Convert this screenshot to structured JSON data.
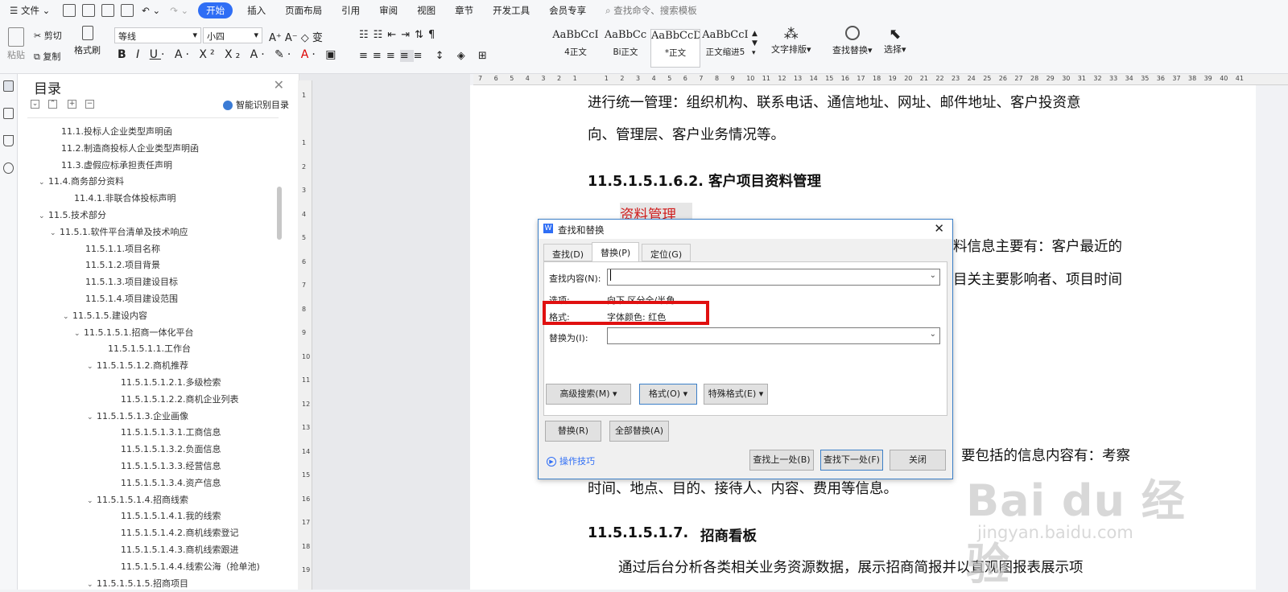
{
  "menubar": {
    "file": "文件",
    "tabs": [
      "开始",
      "插入",
      "页面布局",
      "引用",
      "审阅",
      "视图",
      "章节",
      "开发工具",
      "会员专享"
    ],
    "active_tab": "开始",
    "search_placeholder": "查找命令、搜索模板"
  },
  "ribbon": {
    "paste": "粘贴",
    "cut": "剪切",
    "copy": "复制",
    "format_painter": "格式刷",
    "font_name": "等线",
    "font_size": "小四",
    "styles": [
      {
        "preview": "AaBbCcI",
        "label": "4正文"
      },
      {
        "preview": "AaBbCc",
        "label": "Bi正文"
      },
      {
        "preview": "AaBbCcDc",
        "label": "*正文"
      },
      {
        "preview": "AaBbCcI",
        "label": "正文缩进5"
      }
    ],
    "text_layout": "文字排版",
    "find_replace": "查找替换",
    "select": "选择"
  },
  "toc": {
    "title": "目录",
    "smart": "智能识别目录",
    "items": [
      {
        "text": "11.1.投标人企业类型声明函",
        "caret": ""
      },
      {
        "text": "11.2.制造商投标人企业类型声明函",
        "caret": ""
      },
      {
        "text": "11.3.虚假应标承担责任声明",
        "caret": ""
      },
      {
        "text": "11.4.商务部分资料",
        "caret": "v"
      },
      {
        "text": "11.4.1.非联合体投标声明",
        "caret": ""
      },
      {
        "text": "11.5.技术部分",
        "caret": "v"
      },
      {
        "text": "11.5.1.软件平台清单及技术响应",
        "caret": "v"
      },
      {
        "text": "11.5.1.1.项目名称",
        "caret": ""
      },
      {
        "text": "11.5.1.2.项目背景",
        "caret": ""
      },
      {
        "text": "11.5.1.3.项目建设目标",
        "caret": ""
      },
      {
        "text": "11.5.1.4.项目建设范围",
        "caret": ""
      },
      {
        "text": "11.5.1.5.建设内容",
        "caret": "v"
      },
      {
        "text": "11.5.1.5.1.招商一体化平台",
        "caret": "v"
      },
      {
        "text": "11.5.1.5.1.1.工作台",
        "caret": ""
      },
      {
        "text": "11.5.1.5.1.2.商机推荐",
        "caret": "v"
      },
      {
        "text": "11.5.1.5.1.2.1.多级检索",
        "caret": ""
      },
      {
        "text": "11.5.1.5.1.2.2.商机企业列表",
        "caret": ""
      },
      {
        "text": "11.5.1.5.1.3.企业画像",
        "caret": "v"
      },
      {
        "text": "11.5.1.5.1.3.1.工商信息",
        "caret": ""
      },
      {
        "text": "11.5.1.5.1.3.2.负面信息",
        "caret": ""
      },
      {
        "text": "11.5.1.5.1.3.3.经营信息",
        "caret": ""
      },
      {
        "text": "11.5.1.5.1.3.4.资产信息",
        "caret": ""
      },
      {
        "text": "11.5.1.5.1.4.招商线索",
        "caret": "v"
      },
      {
        "text": "11.5.1.5.1.4.1.我的线索",
        "caret": ""
      },
      {
        "text": "11.5.1.5.1.4.2.商机线索登记",
        "caret": ""
      },
      {
        "text": "11.5.1.5.1.4.3.商机线索跟进",
        "caret": ""
      },
      {
        "text": "11.5.1.5.1.4.4.线索公海（抢单池)",
        "caret": ""
      },
      {
        "text": "11.5.1.5.1.5.招商项目",
        "caret": "v"
      }
    ]
  },
  "doc": {
    "line1": "进行统一管理：组织机构、联系电话、通信地址、网址、邮件地址、客户投资意",
    "line2": "向、管理层、客户业务情况等。",
    "heading1": "11.5.1.5.1.6.2.  客户项目资料管理",
    "highlight": "资料管理",
    "line3_tail": "料信息主要有：客户最近的",
    "line4_tail": "目关主要影响者、项目时间",
    "line5_tail": "要包括的信息内容有：考察",
    "line6": "时间、地点、目的、接待人、内容、费用等信息。",
    "heading2_num": "11.5.1.5.1.7.",
    "heading2_text": "招商看板",
    "line7": "通过后台分析各类相关业务资源数据，展示招商简报并以直观图报表展示项"
  },
  "dialog": {
    "title": "查找和替换",
    "tabs": [
      "查找(D)",
      "替换(P)",
      "定位(G)"
    ],
    "find_label": "查找内容(N):",
    "find_value": "",
    "options_label": "选项:",
    "options_value": "向下,区分全/半角",
    "format_label": "格式:",
    "format_value": "字体颜色: 红色",
    "replace_label": "替换为(I):",
    "replace_value": "",
    "advanced": "高级搜索(M)",
    "format_btn": "格式(O)",
    "special": "特殊格式(E)",
    "replace_btn": "替换(R)",
    "replace_all": "全部替换(A)",
    "tips": "操作技巧",
    "find_prev": "查找上一处(B)",
    "find_next": "查找下一处(F)",
    "close": "关闭"
  },
  "watermark": {
    "big": "Bai du 经验",
    "small": "jingyan.baidu.com"
  },
  "ruler": {
    "horizontal": [
      "7",
      "6",
      "5",
      "4",
      "3",
      "2",
      "1",
      "",
      "1",
      "2",
      "3",
      "4",
      "5",
      "6",
      "7",
      "8",
      "9",
      "10",
      "11",
      "12",
      "13",
      "14",
      "15",
      "16",
      "17",
      "18",
      "19",
      "20",
      "21",
      "22",
      "23",
      "24",
      "25",
      "26",
      "27",
      "28",
      "29",
      "30",
      "31",
      "32",
      "33",
      "34",
      "35",
      "36",
      "37",
      "38",
      "39",
      "40",
      "41"
    ],
    "vertical": [
      "1",
      "",
      "1",
      "2",
      "3",
      "4",
      "5",
      "6",
      "7",
      "8",
      "9",
      "10",
      "11",
      "12",
      "13",
      "14",
      "15",
      "16",
      "17",
      "18",
      "19"
    ]
  }
}
